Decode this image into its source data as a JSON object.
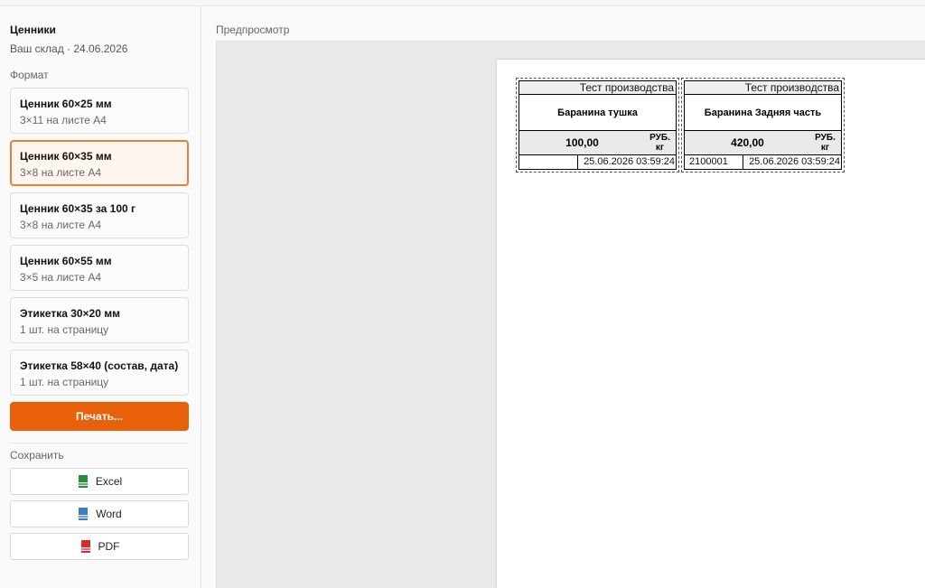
{
  "sidebar": {
    "title": "Ценники",
    "subtitle": "Ваш склад · 24.06.2026",
    "format_label": "Формат",
    "formats": [
      {
        "title": "Ценник 60×25 мм",
        "sub": "3×11 на листе А4",
        "selected": false
      },
      {
        "title": "Ценник 60×35 мм",
        "sub": "3×8 на листе А4",
        "selected": true
      },
      {
        "title": "Ценник 60×35 за 100 г",
        "sub": "3×8 на листе А4",
        "selected": false
      },
      {
        "title": "Ценник 60×55 мм",
        "sub": "3×5 на листе А4",
        "selected": false
      },
      {
        "title": "Этикетка 30×20 мм",
        "sub": "1 шт. на страницу",
        "selected": false
      },
      {
        "title": "Этикетка 58×40 (состав, дата)",
        "sub": "1 шт. на страницу",
        "selected": false
      }
    ],
    "print_label": "Печать...",
    "save_label": "Сохранить",
    "save_buttons": [
      {
        "label": "Excel",
        "icon": "excel-file-icon",
        "color": "#2e8b3e"
      },
      {
        "label": "Word",
        "icon": "word-file-icon",
        "color": "#3a7fc4"
      },
      {
        "label": "PDF",
        "icon": "pdf-file-icon",
        "color": "#d32f2f"
      }
    ]
  },
  "preview": {
    "label": "Предпросмотр",
    "tags": [
      {
        "producer": "Тест производства",
        "name": "Баранина тушка",
        "price": "100,00",
        "unit_top": "РУБ.",
        "unit_bottom": "кг",
        "code": "",
        "date": "25.06.2026 03:59:24"
      },
      {
        "producer": "Тест производства",
        "name": "Баранина Задняя часть",
        "price": "420,00",
        "unit_top": "РУБ.",
        "unit_bottom": "кг",
        "code": "2100001",
        "date": "25.06.2026 03:59:24"
      }
    ]
  },
  "colors": {
    "accent": "#e8600a",
    "selected_border": "#e87f36",
    "selected_bg": "#fff6f0"
  }
}
